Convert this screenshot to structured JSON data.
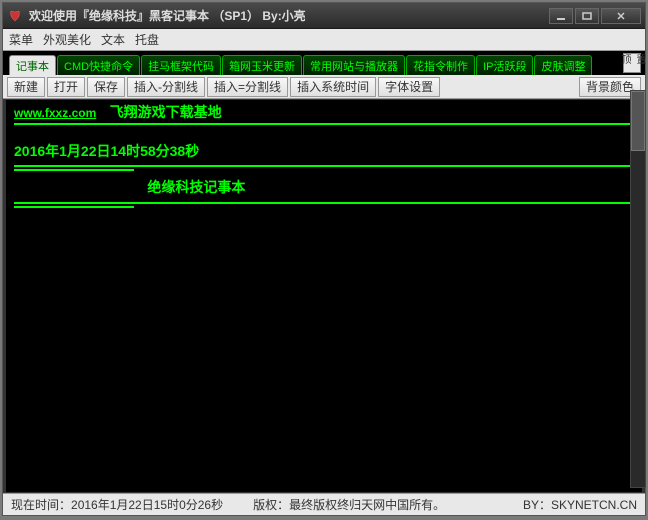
{
  "window": {
    "title": "欢迎使用『绝缘科技』黑客记事本 （SP1）   By:小亮"
  },
  "menu": {
    "items": [
      "菜单",
      "外观美化",
      "文本",
      "托盘"
    ]
  },
  "tabs": {
    "items": [
      "记事本",
      "CMD快捷命令",
      "挂马框架代码",
      "箱网玉米更新",
      "常用网站与播放器",
      "花指令制作",
      "IP活跃段",
      "皮肤调整"
    ],
    "sidebtn": "置\n顶"
  },
  "toolbar": {
    "new": "新建",
    "open": "打开",
    "save": "保存",
    "insert_dash": "插入-分割线",
    "insert_eq": "插入=分割线",
    "insert_time": "插入系统时间",
    "font": "字体设置",
    "bgcolor": "背景颜色"
  },
  "editor": {
    "url": "www.fxxz.com",
    "url_label": "飞翔游戏下载基地",
    "timestamp": "2016年1月22日14时58分38秒",
    "title_center": "绝缘科技记事本"
  },
  "status": {
    "time_label": "现在时间：",
    "time_value": "2016年1月22日15时0分26秒",
    "copyright": "版权：最终版权终归天网中国所有。",
    "by": "BY：SKYNETCN.CN"
  }
}
